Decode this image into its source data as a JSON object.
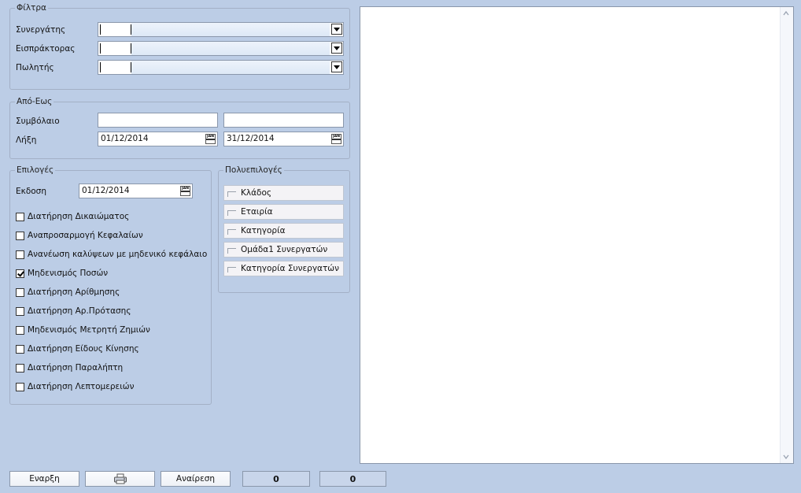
{
  "filters": {
    "title": "Φίλτρα",
    "partner_label": "Συνεργάτης",
    "collector_label": "Εισπράκτορας",
    "seller_label": "Πωλητής"
  },
  "range": {
    "title": "Από-Εως",
    "contract_label": "Συμβόλαιο",
    "contract_from": "",
    "contract_to": "",
    "expiry_label": "Λήξη",
    "expiry_from": "01/12/2014",
    "expiry_to": "31/12/2014"
  },
  "options": {
    "title": "Επιλογές",
    "issue_label": "Εκδοση",
    "issue_date": "01/12/2014",
    "checkboxes": [
      {
        "label": "Διατήρηση Δικαιώματος",
        "checked": false
      },
      {
        "label": "Αναπροσαρμογή Κεφαλαίων",
        "checked": false
      },
      {
        "label": "Ανανέωση καλύψεων με μηδενικό κεφάλαιο",
        "checked": false
      },
      {
        "label": "Μηδενισμός Ποσών",
        "checked": true
      },
      {
        "label": "Διατήρηση Αρίθμησης",
        "checked": false
      },
      {
        "label": "Διατήρηση Αρ.Πρότασης",
        "checked": false
      },
      {
        "label": "Μηδενισμός Μετρητή Ζημιών",
        "checked": false
      },
      {
        "label": "Διατήρηση Είδους Κίνησης",
        "checked": false
      },
      {
        "label": "Διατήρηση Παραλήπτη",
        "checked": false
      },
      {
        "label": "Διατήρηση Λεπτομερειών",
        "checked": false
      }
    ]
  },
  "multi": {
    "title": "Πολυεπιλογές",
    "items": [
      "Κλάδος",
      "Εταιρία",
      "Κατηγορία",
      "Ομάδα1 Συνεργατών",
      "Κατηγορία Συνεργατών"
    ]
  },
  "calendar_icon_text": "JAN",
  "toolbar": {
    "start_label": "Εναρξη",
    "cancel_label": "Αναίρεση",
    "counter1": "0",
    "counter2": "0"
  }
}
